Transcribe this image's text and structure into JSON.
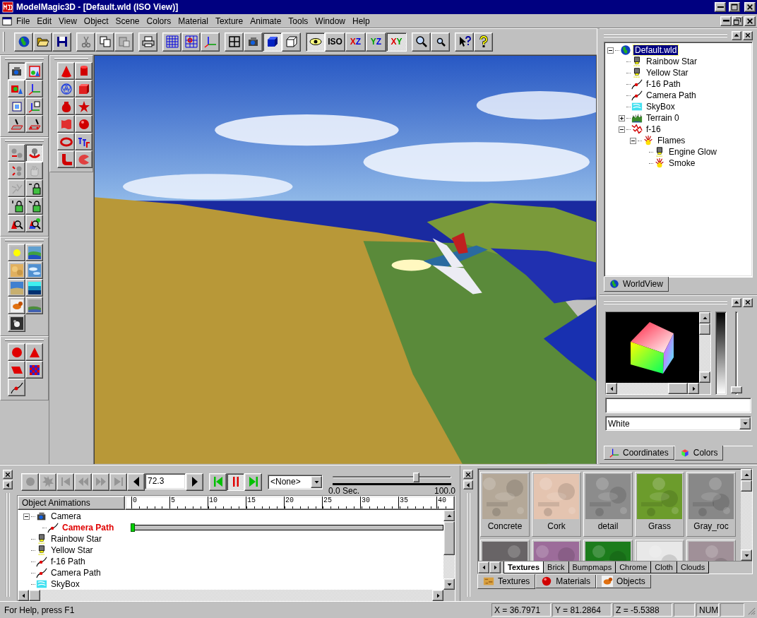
{
  "window": {
    "title": "ModelMagic3D - [Default.wld (ISO View)]"
  },
  "menu": [
    "File",
    "Edit",
    "View",
    "Object",
    "Scene",
    "Colors",
    "Material",
    "Texture",
    "Animate",
    "Tools",
    "Window",
    "Help"
  ],
  "toolbar": {
    "groups": [
      {
        "buttons": [
          {
            "kind": "icon",
            "pressed": false,
            "disabled": false
          },
          {
            "kind": "icon",
            "pressed": false,
            "disabled": false
          },
          {
            "kind": "icon",
            "pressed": false,
            "disabled": false
          }
        ]
      },
      {
        "buttons": [
          {
            "kind": "icon",
            "pressed": false,
            "disabled": true
          },
          {
            "kind": "icon",
            "pressed": false,
            "disabled": false
          },
          {
            "kind": "icon",
            "pressed": false,
            "disabled": true
          }
        ]
      },
      {
        "buttons": [
          {
            "kind": "icon",
            "pressed": false,
            "disabled": false
          }
        ]
      },
      {
        "buttons": [
          {
            "kind": "icon",
            "pressed": false,
            "disabled": false
          },
          {
            "kind": "icon",
            "pressed": false,
            "disabled": false
          },
          {
            "kind": "icon",
            "pressed": false,
            "disabled": false
          }
        ]
      },
      {
        "buttons": [
          {
            "kind": "icon",
            "pressed": false,
            "disabled": false
          },
          {
            "kind": "icon",
            "pressed": false,
            "disabled": false
          },
          {
            "kind": "icon",
            "pressed": true,
            "disabled": false
          },
          {
            "kind": "icon",
            "pressed": false,
            "disabled": false
          }
        ]
      },
      {
        "buttons": [
          {
            "kind": "icon",
            "pressed": true,
            "disabled": false
          },
          {
            "kind": "text",
            "letters": [
              {
                "text": "ISO",
                "color": "#000000"
              }
            ],
            "pressed": false,
            "disabled": false
          },
          {
            "kind": "text",
            "letters": [
              {
                "text": "X",
                "color": "#e00000"
              },
              {
                "text": "Z",
                "color": "#0000e0"
              }
            ],
            "pressed": false,
            "disabled": false
          },
          {
            "kind": "text",
            "letters": [
              {
                "text": "Y",
                "color": "#00a000"
              },
              {
                "text": "Z",
                "color": "#0000e0"
              }
            ],
            "pressed": false,
            "disabled": false
          },
          {
            "kind": "text",
            "letters": [
              {
                "text": "X",
                "color": "#e00000"
              },
              {
                "text": "Y",
                "color": "#00a000"
              }
            ],
            "pressed": true,
            "disabled": false
          }
        ]
      },
      {
        "buttons": [
          {
            "kind": "icon",
            "pressed": false,
            "disabled": false
          },
          {
            "kind": "icon",
            "pressed": false,
            "disabled": false
          }
        ]
      },
      {
        "buttons": [
          {
            "kind": "icon",
            "pressed": false,
            "disabled": false
          },
          {
            "kind": "icon",
            "pressed": false,
            "disabled": false
          }
        ]
      }
    ]
  },
  "palettes": [
    {
      "buttons": [
        {
          "pressed": true,
          "disabled": false
        },
        {
          "pressed": false,
          "disabled": false
        },
        {
          "pressed": false,
          "disabled": false
        },
        {
          "pressed": false,
          "disabled": false
        },
        {
          "pressed": false,
          "disabled": false
        },
        {
          "pressed": false,
          "disabled": false
        },
        {
          "pressed": false,
          "disabled": false
        },
        {
          "pressed": false,
          "disabled": false
        }
      ]
    },
    {
      "buttons": [
        {
          "pressed": false,
          "disabled": false
        },
        {
          "pressed": true,
          "disabled": false
        },
        {
          "pressed": false,
          "disabled": false
        },
        {
          "pressed": false,
          "disabled": true
        },
        {
          "pressed": false,
          "disabled": true
        },
        {
          "pressed": false,
          "disabled": false
        },
        {
          "pressed": false,
          "disabled": false
        },
        {
          "pressed": false,
          "disabled": false
        },
        {
          "pressed": false,
          "disabled": false
        },
        {
          "pressed": false,
          "disabled": false
        }
      ]
    },
    {
      "buttons": [
        {
          "pressed": false,
          "disabled": false
        },
        {
          "pressed": false,
          "disabled": false
        },
        {
          "pressed": false,
          "disabled": false
        },
        {
          "pressed": false,
          "disabled": false
        },
        {
          "pressed": false,
          "disabled": false
        },
        {
          "pressed": false,
          "disabled": false
        },
        {
          "pressed": false,
          "disabled": false
        },
        {
          "pressed": false,
          "disabled": false
        },
        {
          "pressed": false,
          "disabled": false
        }
      ]
    },
    {
      "buttons": [
        {
          "pressed": false,
          "disabled": false
        },
        {
          "pressed": false,
          "disabled": false
        },
        {
          "pressed": false,
          "disabled": false
        },
        {
          "pressed": false,
          "disabled": false
        },
        {
          "pressed": false,
          "disabled": false
        }
      ]
    },
    {
      "buttons": [
        {
          "pressed": false,
          "disabled": false
        },
        {
          "pressed": false,
          "disabled": false
        },
        {
          "pressed": false,
          "disabled": false
        },
        {
          "pressed": false,
          "disabled": false
        },
        {
          "pressed": false,
          "disabled": false
        },
        {
          "pressed": false,
          "disabled": false
        },
        {
          "pressed": false,
          "disabled": false
        },
        {
          "pressed": false,
          "disabled": false
        },
        {
          "pressed": false,
          "disabled": false
        },
        {
          "pressed": false,
          "disabled": false
        },
        {
          "pressed": false,
          "disabled": false
        },
        {
          "pressed": false,
          "disabled": false
        }
      ]
    }
  ],
  "world_view": {
    "tree": [
      {
        "label": "Default.wld",
        "kind": "world",
        "selected": true,
        "expanded": true,
        "children": [
          {
            "label": "Rainbow Star",
            "kind": "light",
            "selected": false
          },
          {
            "label": "Yellow Star",
            "kind": "light",
            "selected": false
          },
          {
            "label": "f-16 Path",
            "kind": "path",
            "selected": false
          },
          {
            "label": "Camera Path",
            "kind": "path",
            "selected": false
          },
          {
            "label": "SkyBox",
            "kind": "skybox",
            "selected": false
          },
          {
            "label": "Terrain 0",
            "kind": "terrain",
            "selected": false,
            "expanded": false
          },
          {
            "label": "f-16",
            "kind": "mesh",
            "selected": false,
            "expanded": true,
            "children": [
              {
                "label": "Flames",
                "kind": "particles",
                "selected": false,
                "expanded": true,
                "children": [
                  {
                    "label": "Engine Glow",
                    "kind": "light",
                    "selected": false
                  },
                  {
                    "label": "Smoke",
                    "kind": "particles",
                    "selected": false
                  }
                ]
              }
            ]
          }
        ]
      }
    ],
    "tabs": [
      {
        "label": "WorldView",
        "selected": true
      }
    ]
  },
  "colors": {
    "brightness": {
      "level": 0
    },
    "color_name": "White",
    "tabs": [
      {
        "label": "Coordinates",
        "selected": false
      },
      {
        "label": "Colors",
        "selected": true
      }
    ]
  },
  "animation": {
    "transport": [
      {
        "disabled": true
      },
      {
        "disabled": true
      },
      {
        "disabled": true
      },
      {
        "disabled": true
      },
      {
        "disabled": true
      },
      {
        "disabled": true
      }
    ],
    "frame": "72.3",
    "play": [
      {
        "pressed": false
      },
      {
        "pressed": true
      },
      {
        "pressed": false
      }
    ],
    "target": "<None>",
    "time": {
      "level": 0.72,
      "start": "0.0 Sec.",
      "end": "100.0"
    },
    "header": "Object Animations",
    "ruler": [
      "0",
      "5",
      "10",
      "15",
      "20",
      "25",
      "30",
      "35",
      "40"
    ],
    "rows": [
      {
        "label": "Camera",
        "kind": "camera",
        "selected": false,
        "track": false,
        "expanded": true,
        "children": [
          {
            "label": "Camera Path",
            "kind": "path",
            "selected": true,
            "track": true
          }
        ]
      },
      {
        "label": "Rainbow Star",
        "kind": "light",
        "selected": false,
        "track": false
      },
      {
        "label": "Yellow Star",
        "kind": "light",
        "selected": false,
        "track": false
      },
      {
        "label": "f-16 Path",
        "kind": "path",
        "selected": false,
        "track": false
      },
      {
        "label": "Camera Path",
        "kind": "path",
        "selected": false,
        "track": false
      },
      {
        "label": "SkyBox",
        "kind": "skybox",
        "selected": false,
        "track": false
      }
    ]
  },
  "library": {
    "items": [
      {
        "label": "Concrete",
        "color": "#b4a898"
      },
      {
        "label": "Cork",
        "color": "#e4c4b0"
      },
      {
        "label": "detail",
        "color": "#8c8c8c"
      },
      {
        "label": "Grass",
        "color": "#6c9c2c"
      },
      {
        "label": "Gray_roc",
        "color": "#888888"
      },
      {
        "color": "#686466"
      },
      {
        "color": "#9c6c9a"
      },
      {
        "color": "#1c7c1c"
      },
      {
        "color": "#e8e8e8"
      },
      {
        "color": "#a09098"
      }
    ],
    "categories": [
      {
        "label": "Textures",
        "selected": true
      },
      {
        "label": "Brick",
        "selected": false
      },
      {
        "label": "Bumpmaps",
        "selected": false
      },
      {
        "label": "Chrome",
        "selected": false
      },
      {
        "label": "Cloth",
        "selected": false
      },
      {
        "label": "Clouds",
        "selected": false
      }
    ],
    "tabs": [
      {
        "label": "Textures",
        "selected": true
      },
      {
        "label": "Materials",
        "selected": false
      },
      {
        "label": "Objects",
        "selected": false
      }
    ]
  },
  "status_bar": {
    "help": "For Help, press F1",
    "coordinates": [
      "X = 36.7971",
      "Y = 81.2864",
      "Z = -5.5388"
    ],
    "indicators": [
      "NUM"
    ]
  }
}
